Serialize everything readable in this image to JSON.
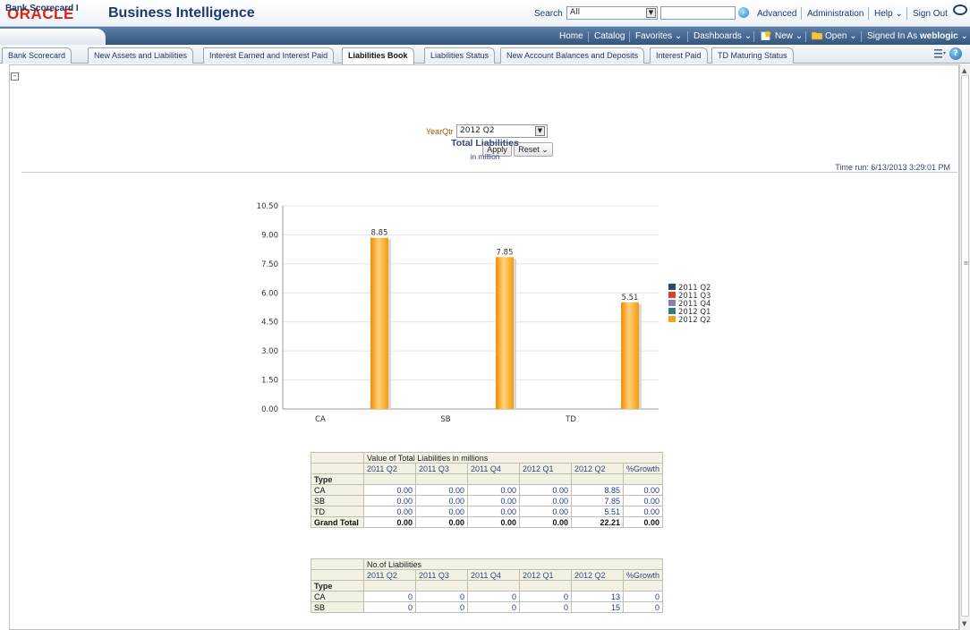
{
  "header": {
    "logo": "ORACLE",
    "product": "Business Intelligence",
    "search_label": "Search",
    "search_scope": "All",
    "links": [
      "Advanced",
      "Administration",
      "Help",
      "Sign Out"
    ]
  },
  "navbar": {
    "dashboard_tab": "Bank Scorecard I",
    "links": [
      "Home",
      "Catalog",
      "Favorites",
      "Dashboards",
      "New",
      "Open"
    ],
    "signed_in_prefix": "Signed In As",
    "user": "weblogic"
  },
  "tabs": [
    "Bank Scorecard",
    "New Assets and Liabilities",
    "Interest Earned and Interest Paid",
    "Liabilities Book",
    "Liabilities Status",
    "New Account Balances and Deposits",
    "Interest Paid",
    "TD Maturing Status"
  ],
  "active_tab": "Liabilities Book",
  "prompt": {
    "label": "YearQtr",
    "value": "2012 Q2",
    "apply": "Apply",
    "reset": "Reset"
  },
  "report": {
    "title": "Total Liabilities",
    "subtitle": "in million",
    "time_run": "Time run: 6/13/2013 3:29:01 PM"
  },
  "chart_data": {
    "type": "bar",
    "categories": [
      "CA",
      "SB",
      "TD"
    ],
    "series": [
      {
        "name": "2011 Q2",
        "color": "#2e4a6b",
        "values": [
          0,
          0,
          0
        ]
      },
      {
        "name": "2011 Q3",
        "color": "#d2462a",
        "values": [
          0,
          0,
          0
        ]
      },
      {
        "name": "2011 Q4",
        "color": "#8a7fb0",
        "values": [
          0,
          0,
          0
        ]
      },
      {
        "name": "2012 Q1",
        "color": "#2f7d7d",
        "values": [
          0,
          0,
          0
        ]
      },
      {
        "name": "2012 Q2",
        "color": "#f7a21b",
        "values": [
          8.85,
          7.85,
          5.51
        ]
      }
    ],
    "yticks": [
      "0.00",
      "1.50",
      "3.00",
      "4.50",
      "6.00",
      "7.50",
      "9.00",
      "10.50"
    ],
    "ylim": [
      0,
      10.5
    ],
    "data_labels": [
      "8.85",
      "7.85",
      "5.51"
    ],
    "legend": "right",
    "grid": true
  },
  "table1": {
    "caption": "Value of Total Liabilities in millions",
    "columns": [
      "2011 Q2",
      "2011 Q3",
      "2011 Q4",
      "2012 Q1",
      "2012 Q2",
      "%Growth"
    ],
    "type_label": "Type",
    "rows": [
      {
        "label": "CA",
        "values": [
          "0.00",
          "0.00",
          "0.00",
          "0.00",
          "8.85",
          "0.00"
        ]
      },
      {
        "label": "SB",
        "values": [
          "0.00",
          "0.00",
          "0.00",
          "0.00",
          "7.85",
          "0.00"
        ]
      },
      {
        "label": "TD",
        "values": [
          "0.00",
          "0.00",
          "0.00",
          "0.00",
          "5.51",
          "0.00"
        ]
      }
    ],
    "total": {
      "label": "Grand Total",
      "values": [
        "0.00",
        "0.00",
        "0.00",
        "0.00",
        "22.21",
        "0.00"
      ]
    }
  },
  "table2": {
    "caption": "No.of Liabilities",
    "columns": [
      "2011 Q2",
      "2011 Q3",
      "2011 Q4",
      "2012 Q1",
      "2012 Q2",
      "%Growth"
    ],
    "type_label": "Type",
    "rows": [
      {
        "label": "CA",
        "values": [
          "0",
          "0",
          "0",
          "0",
          "13",
          "0"
        ]
      },
      {
        "label": "SB",
        "values": [
          "0",
          "0",
          "0",
          "0",
          "15",
          "0"
        ]
      }
    ]
  }
}
